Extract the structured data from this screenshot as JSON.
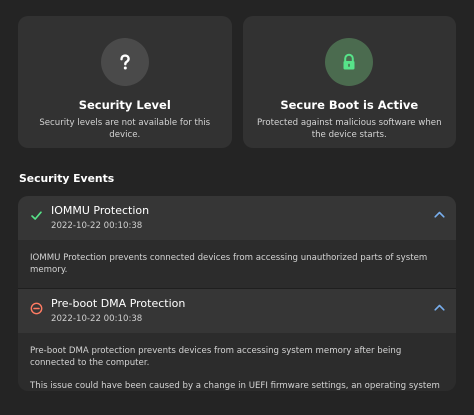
{
  "cards": [
    {
      "icon": "question-mark-icon",
      "title": "Security Level",
      "description": "Security levels are not available for this device."
    },
    {
      "icon": "lock-icon",
      "title": "Secure Boot is Active",
      "description": "Protected against malicious software when the device starts."
    }
  ],
  "colors": {
    "background": "#242424",
    "card": "#323232",
    "success": "#57e389",
    "error": "#ff7b63",
    "accent": "#78aeed",
    "lock_bg": "#4b6b4f"
  },
  "security_events": {
    "title": "Security Events",
    "items": [
      {
        "status_icon": "check-icon",
        "title": "IOMMU Protection",
        "timestamp": "2022-10-22 00:10:38",
        "expanded": true,
        "body": [
          "IOMMU Protection prevents connected devices from accessing unauthorized parts of system memory."
        ]
      },
      {
        "status_icon": "error-circle-icon",
        "title": "Pre-boot DMA Protection",
        "timestamp": "2022-10-22 00:10:38",
        "expanded": true,
        "body": [
          "Pre-boot DMA protection prevents devices from accessing system memory after being connected to the computer.",
          "This issue could have been caused by a change in UEFI firmware settings, an operating system configuration change, or because of malicious software on this system."
        ]
      }
    ]
  }
}
